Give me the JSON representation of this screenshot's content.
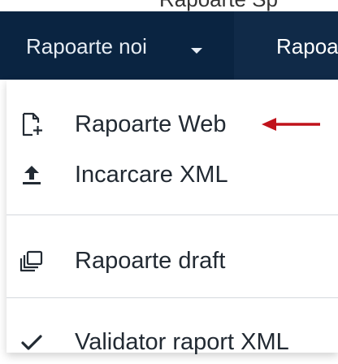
{
  "top_strip": {
    "text": "Rapoarte Sp"
  },
  "navbar": {
    "active_menu_label": "Rapoarte noi",
    "next_menu_label": "Rapoa"
  },
  "dropdown": {
    "items": [
      {
        "label": "Rapoarte Web",
        "icon": "new-file-icon"
      },
      {
        "label": "Incarcare XML",
        "icon": "upload-icon"
      },
      {
        "label": "Rapoarte draft",
        "icon": "drafts-stack-icon"
      },
      {
        "label": "Validator raport XML",
        "icon": "checkmark-icon"
      }
    ]
  },
  "annotation": {
    "arrow_icon": "red-left-arrow-icon",
    "color": "#c0121b"
  },
  "colors": {
    "navbar_bg": "#102a48",
    "navbar_active_bg": "#0a2441",
    "navbar_text": "#e6ecf3",
    "menu_text": "#222a33"
  }
}
